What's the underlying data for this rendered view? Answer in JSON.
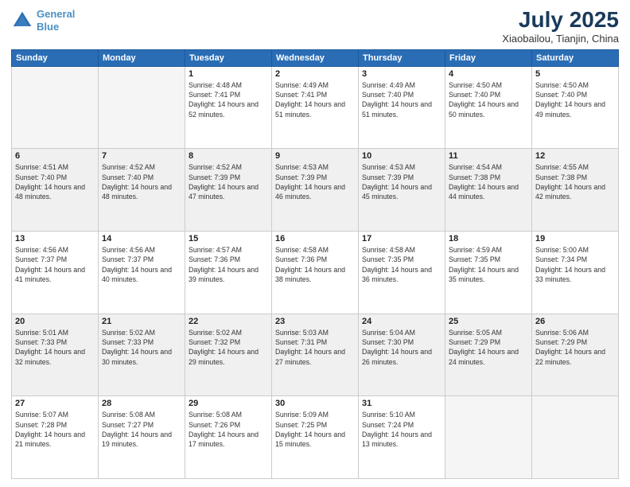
{
  "header": {
    "logo_line1": "General",
    "logo_line2": "Blue",
    "title": "July 2025",
    "subtitle": "Xiaobailou, Tianjin, China"
  },
  "days_of_week": [
    "Sunday",
    "Monday",
    "Tuesday",
    "Wednesday",
    "Thursday",
    "Friday",
    "Saturday"
  ],
  "weeks": [
    [
      {
        "day": "",
        "empty": true
      },
      {
        "day": "",
        "empty": true
      },
      {
        "day": "1",
        "sunrise": "4:48 AM",
        "sunset": "7:41 PM",
        "daylight": "14 hours and 52 minutes."
      },
      {
        "day": "2",
        "sunrise": "4:49 AM",
        "sunset": "7:41 PM",
        "daylight": "14 hours and 51 minutes."
      },
      {
        "day": "3",
        "sunrise": "4:49 AM",
        "sunset": "7:40 PM",
        "daylight": "14 hours and 51 minutes."
      },
      {
        "day": "4",
        "sunrise": "4:50 AM",
        "sunset": "7:40 PM",
        "daylight": "14 hours and 50 minutes."
      },
      {
        "day": "5",
        "sunrise": "4:50 AM",
        "sunset": "7:40 PM",
        "daylight": "14 hours and 49 minutes."
      }
    ],
    [
      {
        "day": "6",
        "sunrise": "4:51 AM",
        "sunset": "7:40 PM",
        "daylight": "14 hours and 48 minutes."
      },
      {
        "day": "7",
        "sunrise": "4:52 AM",
        "sunset": "7:40 PM",
        "daylight": "14 hours and 48 minutes."
      },
      {
        "day": "8",
        "sunrise": "4:52 AM",
        "sunset": "7:39 PM",
        "daylight": "14 hours and 47 minutes."
      },
      {
        "day": "9",
        "sunrise": "4:53 AM",
        "sunset": "7:39 PM",
        "daylight": "14 hours and 46 minutes."
      },
      {
        "day": "10",
        "sunrise": "4:53 AM",
        "sunset": "7:39 PM",
        "daylight": "14 hours and 45 minutes."
      },
      {
        "day": "11",
        "sunrise": "4:54 AM",
        "sunset": "7:38 PM",
        "daylight": "14 hours and 44 minutes."
      },
      {
        "day": "12",
        "sunrise": "4:55 AM",
        "sunset": "7:38 PM",
        "daylight": "14 hours and 42 minutes."
      }
    ],
    [
      {
        "day": "13",
        "sunrise": "4:56 AM",
        "sunset": "7:37 PM",
        "daylight": "14 hours and 41 minutes."
      },
      {
        "day": "14",
        "sunrise": "4:56 AM",
        "sunset": "7:37 PM",
        "daylight": "14 hours and 40 minutes."
      },
      {
        "day": "15",
        "sunrise": "4:57 AM",
        "sunset": "7:36 PM",
        "daylight": "14 hours and 39 minutes."
      },
      {
        "day": "16",
        "sunrise": "4:58 AM",
        "sunset": "7:36 PM",
        "daylight": "14 hours and 38 minutes."
      },
      {
        "day": "17",
        "sunrise": "4:58 AM",
        "sunset": "7:35 PM",
        "daylight": "14 hours and 36 minutes."
      },
      {
        "day": "18",
        "sunrise": "4:59 AM",
        "sunset": "7:35 PM",
        "daylight": "14 hours and 35 minutes."
      },
      {
        "day": "19",
        "sunrise": "5:00 AM",
        "sunset": "7:34 PM",
        "daylight": "14 hours and 33 minutes."
      }
    ],
    [
      {
        "day": "20",
        "sunrise": "5:01 AM",
        "sunset": "7:33 PM",
        "daylight": "14 hours and 32 minutes."
      },
      {
        "day": "21",
        "sunrise": "5:02 AM",
        "sunset": "7:33 PM",
        "daylight": "14 hours and 30 minutes."
      },
      {
        "day": "22",
        "sunrise": "5:02 AM",
        "sunset": "7:32 PM",
        "daylight": "14 hours and 29 minutes."
      },
      {
        "day": "23",
        "sunrise": "5:03 AM",
        "sunset": "7:31 PM",
        "daylight": "14 hours and 27 minutes."
      },
      {
        "day": "24",
        "sunrise": "5:04 AM",
        "sunset": "7:30 PM",
        "daylight": "14 hours and 26 minutes."
      },
      {
        "day": "25",
        "sunrise": "5:05 AM",
        "sunset": "7:29 PM",
        "daylight": "14 hours and 24 minutes."
      },
      {
        "day": "26",
        "sunrise": "5:06 AM",
        "sunset": "7:29 PM",
        "daylight": "14 hours and 22 minutes."
      }
    ],
    [
      {
        "day": "27",
        "sunrise": "5:07 AM",
        "sunset": "7:28 PM",
        "daylight": "14 hours and 21 minutes."
      },
      {
        "day": "28",
        "sunrise": "5:08 AM",
        "sunset": "7:27 PM",
        "daylight": "14 hours and 19 minutes."
      },
      {
        "day": "29",
        "sunrise": "5:08 AM",
        "sunset": "7:26 PM",
        "daylight": "14 hours and 17 minutes."
      },
      {
        "day": "30",
        "sunrise": "5:09 AM",
        "sunset": "7:25 PM",
        "daylight": "14 hours and 15 minutes."
      },
      {
        "day": "31",
        "sunrise": "5:10 AM",
        "sunset": "7:24 PM",
        "daylight": "14 hours and 13 minutes."
      },
      {
        "day": "",
        "empty": true
      },
      {
        "day": "",
        "empty": true
      }
    ]
  ]
}
